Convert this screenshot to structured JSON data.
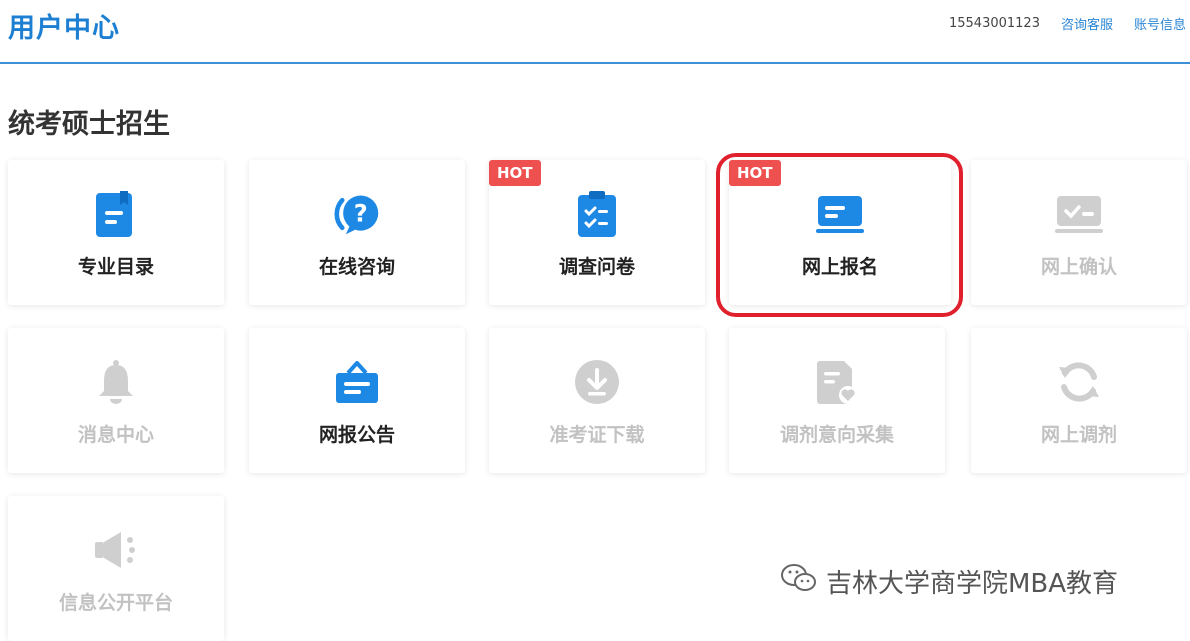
{
  "header": {
    "title": "用户中心",
    "phone": "15543001123",
    "links": [
      "咨询客服",
      "账号信息"
    ]
  },
  "section_title": "统考硕士招生",
  "cards": [
    {
      "label": "专业目录",
      "icon": "catalog-book-icon",
      "enabled": true,
      "hot": false
    },
    {
      "label": "在线咨询",
      "icon": "question-chat-icon",
      "enabled": true,
      "hot": false
    },
    {
      "label": "调查问卷",
      "icon": "clipboard-checklist-icon",
      "enabled": true,
      "hot": true
    },
    {
      "label": "网上报名",
      "icon": "laptop-form-icon",
      "enabled": true,
      "hot": true
    },
    {
      "label": "网上确认",
      "icon": "laptop-check-icon",
      "enabled": false,
      "hot": false
    },
    {
      "label": "消息中心",
      "icon": "bell-icon",
      "enabled": false,
      "hot": false
    },
    {
      "label": "网报公告",
      "icon": "notice-board-icon",
      "enabled": true,
      "hot": false
    },
    {
      "label": "准考证下载",
      "icon": "download-circle-icon",
      "enabled": false,
      "hot": false
    },
    {
      "label": "调剂意向采集",
      "icon": "document-heart-icon",
      "enabled": false,
      "hot": false
    },
    {
      "label": "网上调剂",
      "icon": "refresh-icon",
      "enabled": false,
      "hot": false
    },
    {
      "label": "信息公开平台",
      "icon": "megaphone-icon",
      "enabled": false,
      "hot": false
    }
  ],
  "hot_badge": "HOT",
  "watermark": "吉林大学商学院MBA教育",
  "colors": {
    "accent": "#1d7fd1",
    "icon_blue": "#1e88e5",
    "icon_disabled": "#cfcfcf",
    "hot": "#ee4f4f",
    "highlight": "#e0202d"
  }
}
